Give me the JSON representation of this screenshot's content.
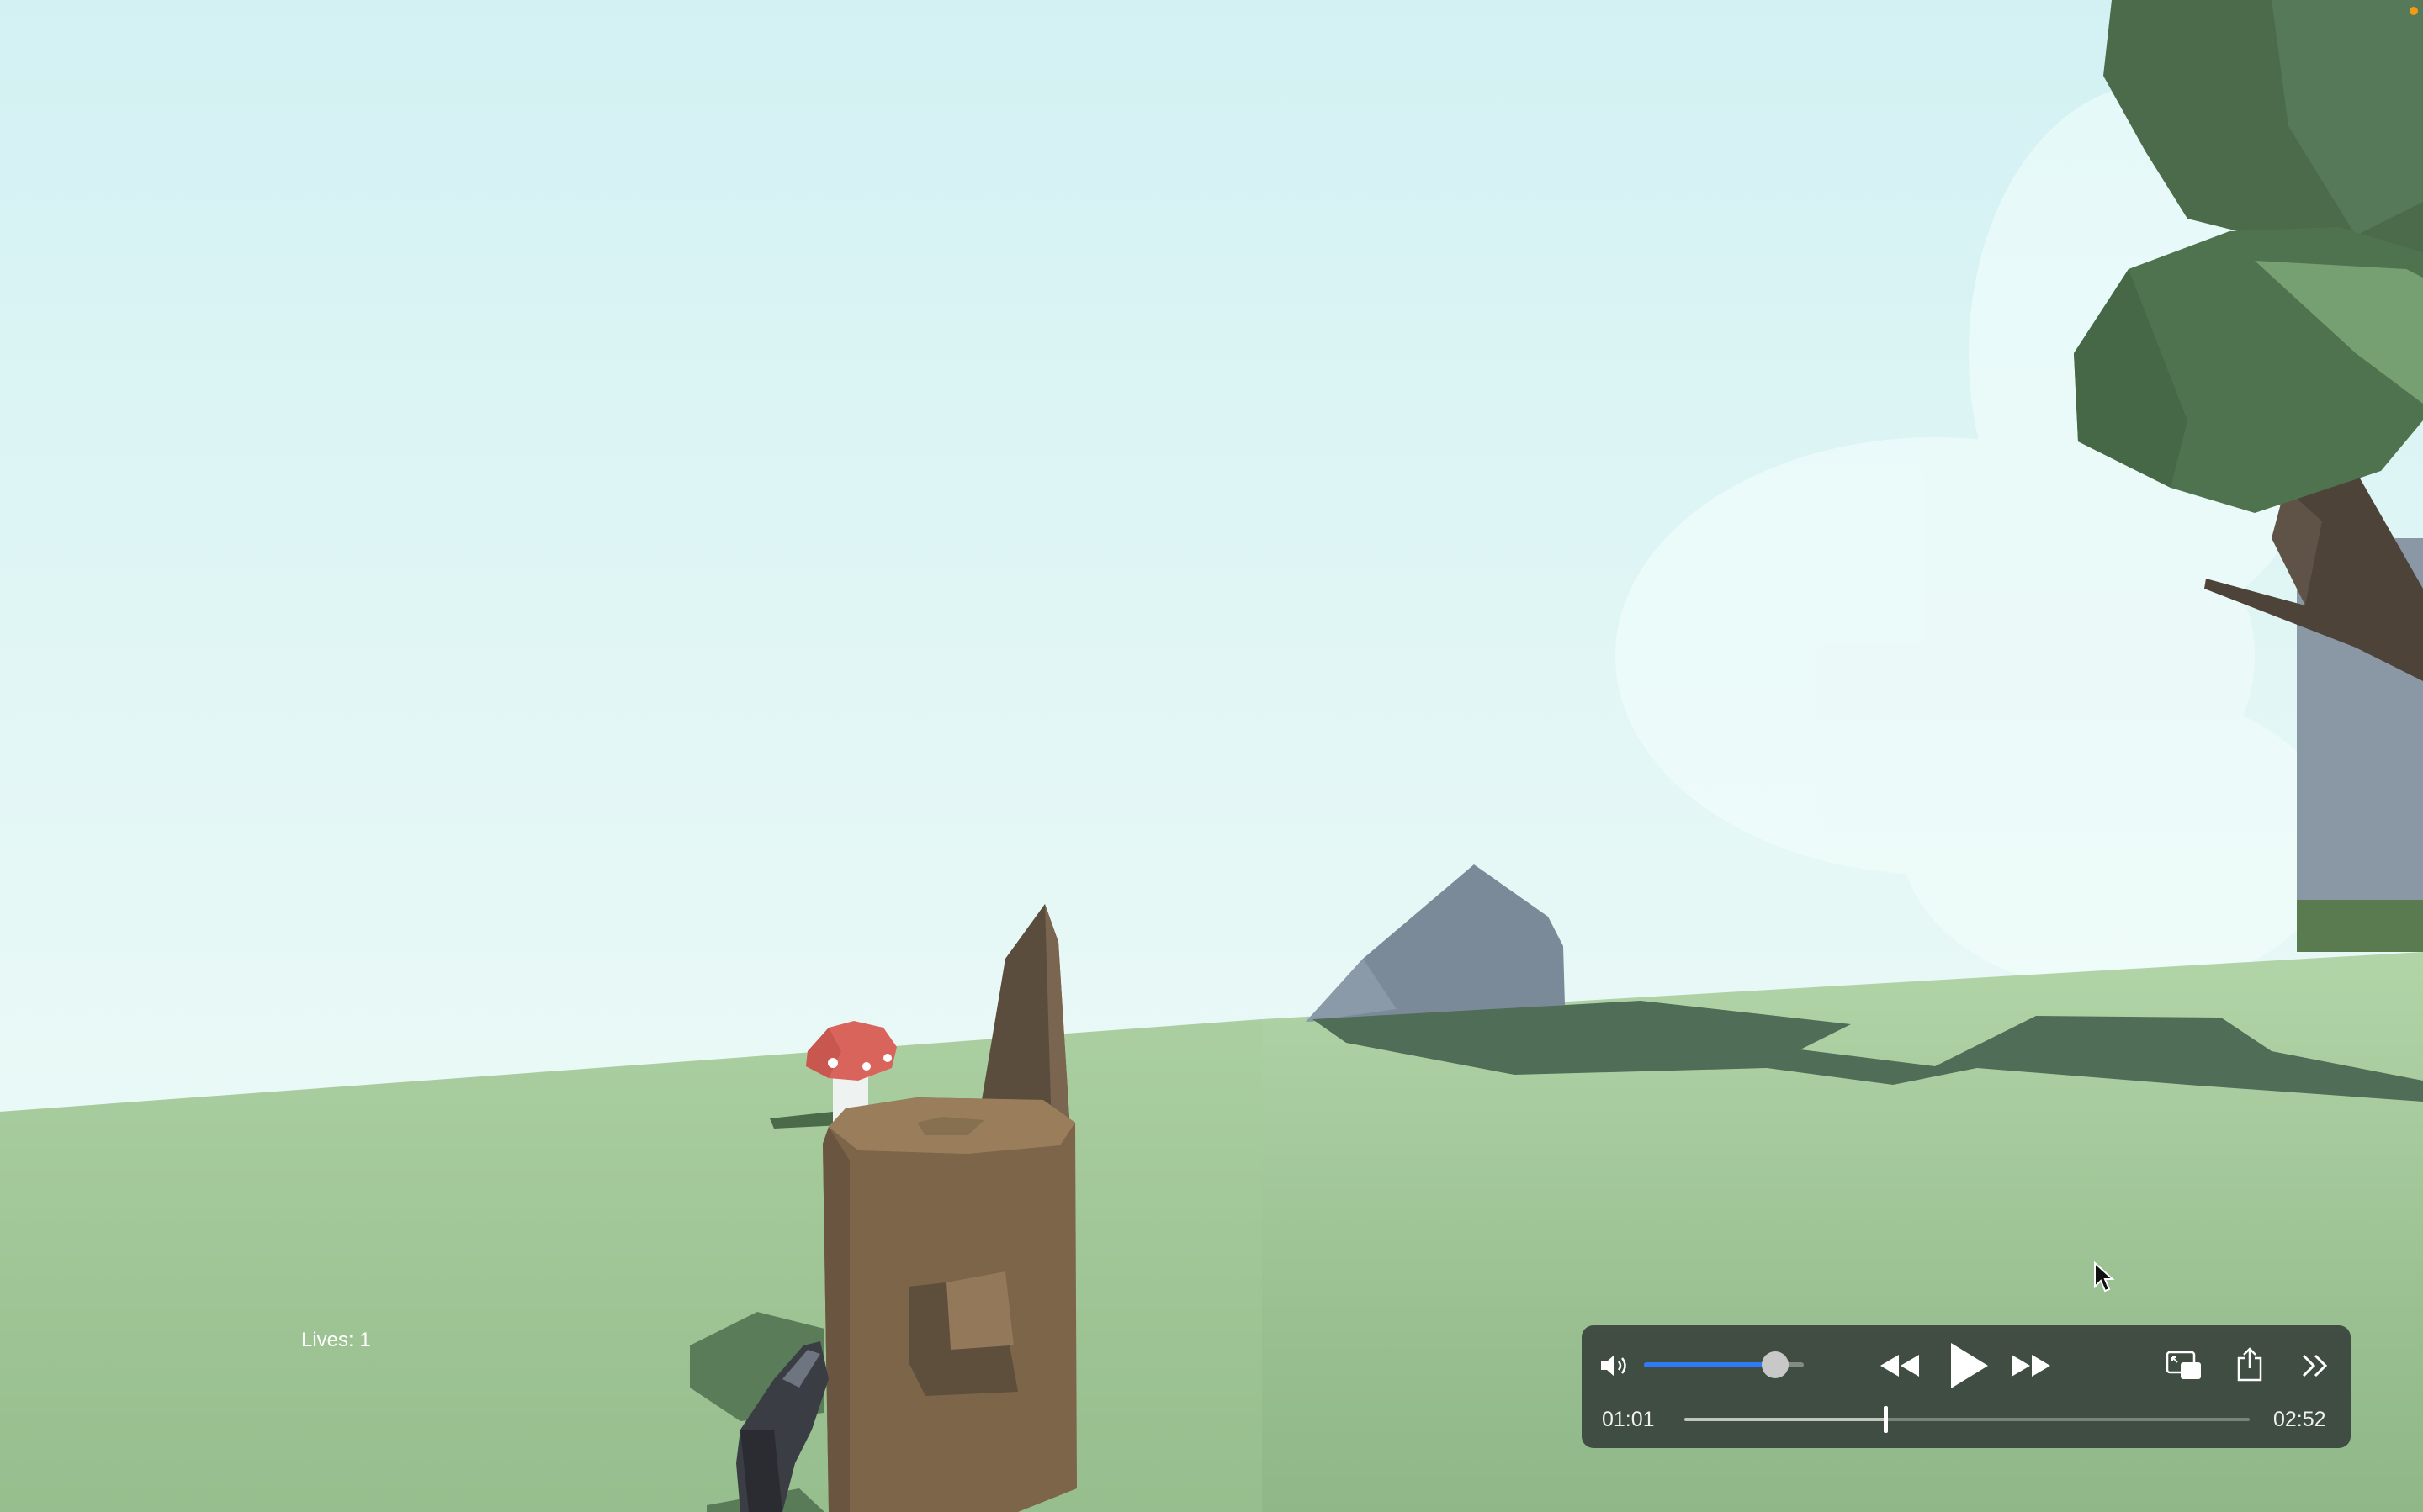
{
  "hud": {
    "lives_text": "Lives: 1"
  },
  "player": {
    "volume_level": 0.82,
    "current_time": "01:01",
    "total_time": "02:52",
    "progress": 0.355,
    "buttons": {
      "volume": "speaker-icon",
      "rewind": "rewind-icon",
      "play": "play-icon",
      "fast_forward": "fast-forward-icon",
      "picture_in_picture": "picture-in-picture-icon",
      "share": "share-icon",
      "more": "chevron-double-right-icon"
    }
  },
  "colors": {
    "sky": "#e6f8f6",
    "grass": "#a3c79a",
    "tree_foliage": "#4d6e4d",
    "stump": "#7c6549",
    "rock": "#7a8a98",
    "mushroom_cap": "#d9645c",
    "volume_fill": "#2f7bf5",
    "recording_dot": "#f39c12"
  }
}
